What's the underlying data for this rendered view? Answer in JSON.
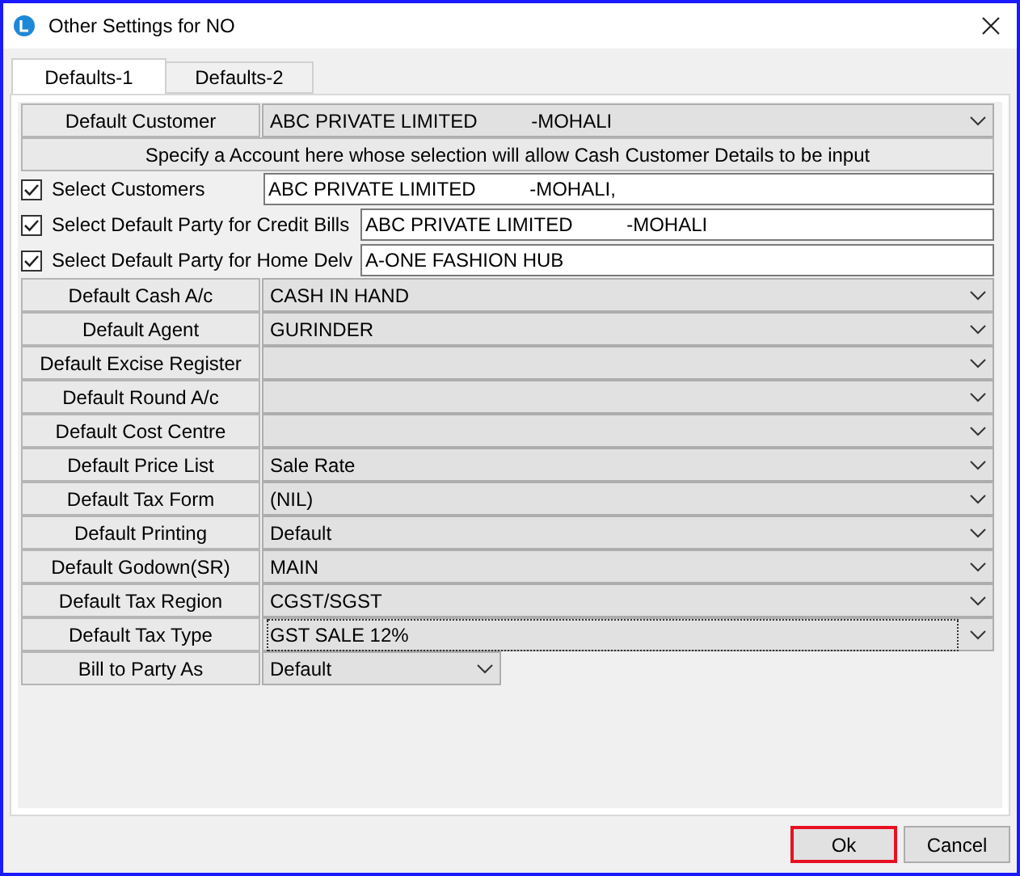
{
  "window": {
    "title": "Other Settings for NO"
  },
  "tabs": [
    {
      "label": "Defaults-1",
      "selected": true
    },
    {
      "label": "Defaults-2",
      "selected": false
    }
  ],
  "rows": [
    {
      "kind": "combo",
      "label": "Default Customer",
      "value": "ABC PRIVATE LIMITED          -MOHALI",
      "focused": false
    },
    {
      "kind": "note",
      "text": "Specify a Account here whose selection will allow Cash Customer Details to be input"
    },
    {
      "kind": "check",
      "label": "Select Customers",
      "checked": true,
      "value": "ABC PRIVATE LIMITED          -MOHALI,",
      "wide": true
    },
    {
      "kind": "check",
      "label": "Select Default Party for Credit Bills",
      "checked": true,
      "value": "ABC PRIVATE LIMITED          -MOHALI",
      "wide": false
    },
    {
      "kind": "check",
      "label": "Select Default Party for Home Delv",
      "checked": true,
      "value": "A-ONE FASHION HUB",
      "wide": false
    },
    {
      "kind": "combo",
      "label": "Default Cash A/c",
      "value": "CASH IN HAND",
      "focused": false
    },
    {
      "kind": "combo",
      "label": "Default Agent",
      "value": "GURINDER",
      "focused": false
    },
    {
      "kind": "combo",
      "label": "Default Excise Register",
      "focused": false
    },
    {
      "kind": "combo",
      "label": "Default Round A/c",
      "focused": false
    },
    {
      "kind": "combo",
      "label": "Default Cost Centre",
      "focused": false
    },
    {
      "kind": "combo",
      "label": "Default Price List",
      "value": "Sale Rate",
      "focused": false
    },
    {
      "kind": "combo",
      "label": "Default Tax Form",
      "value": "(NIL)",
      "focused": false
    },
    {
      "kind": "combo",
      "label": "Default Printing",
      "value": "Default",
      "focused": false
    },
    {
      "kind": "combo",
      "label": "Default Godown(SR)",
      "value": "MAIN",
      "focused": false
    },
    {
      "kind": "combo",
      "label": "Default Tax Region",
      "value": "CGST/SGST",
      "focused": false
    },
    {
      "kind": "combo",
      "label": "Default Tax Type",
      "value": "GST SALE 12%",
      "focused": true
    },
    {
      "kind": "short-combo",
      "label": "Bill to Party As",
      "value": "Default"
    }
  ],
  "buttons": [
    {
      "label": "Ok",
      "default": true
    },
    {
      "label": "Cancel",
      "default": false
    }
  ]
}
